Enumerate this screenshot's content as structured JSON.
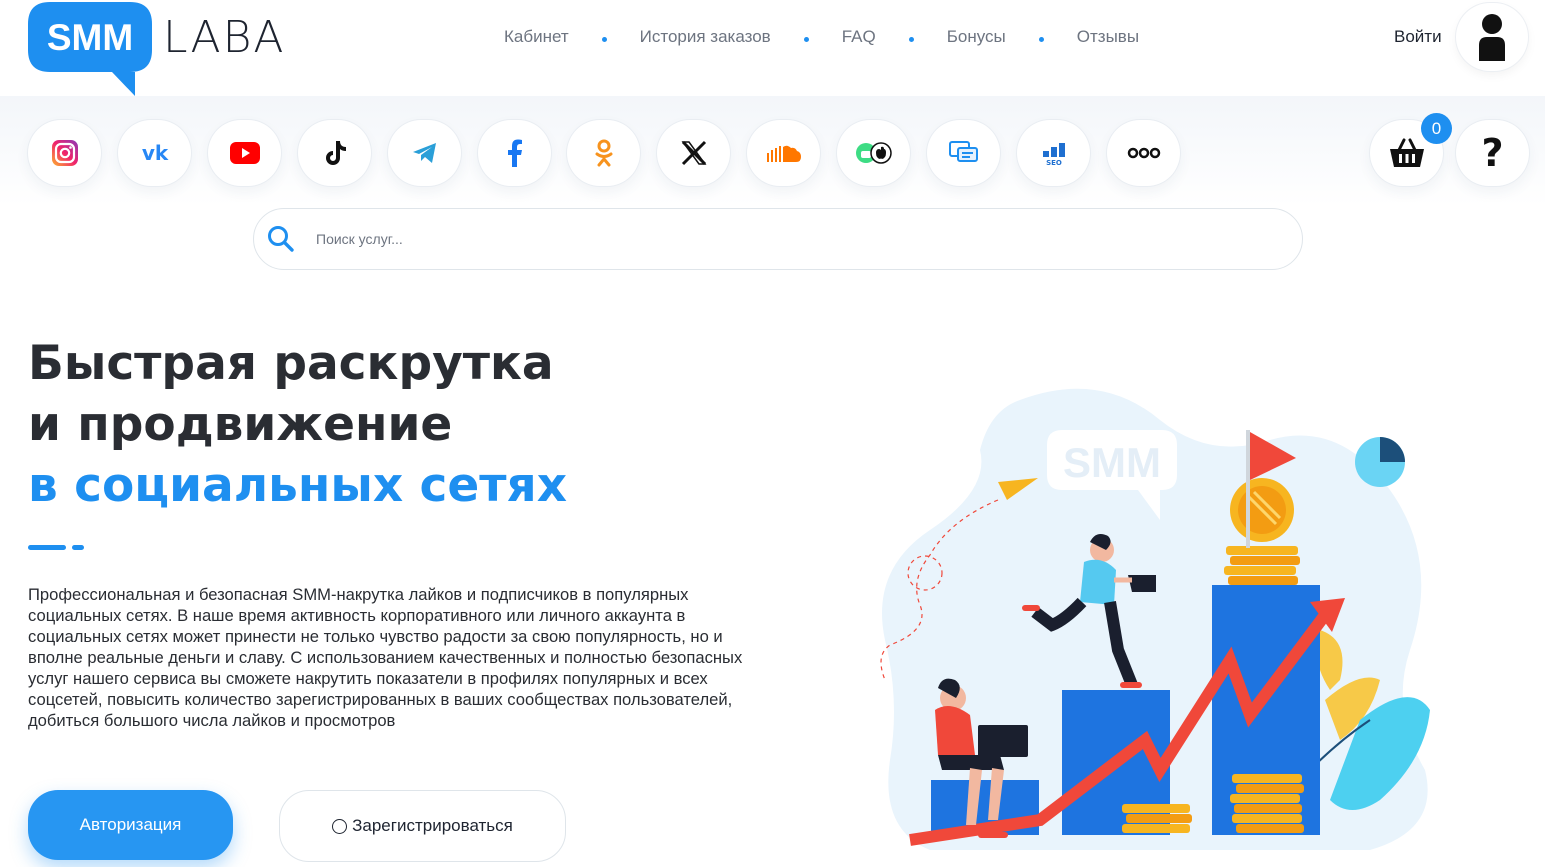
{
  "logo": {
    "part1": "SMM",
    "part2": "LABA"
  },
  "nav": [
    "Кабинет",
    "История заказов",
    "FAQ",
    "Бонусы",
    "Отзывы"
  ],
  "login": {
    "label": "Войти"
  },
  "social_icons": [
    "instagram-icon",
    "vk-icon",
    "youtube-icon",
    "tiktok-icon",
    "telegram-icon",
    "facebook-icon",
    "odnoklassniki-icon",
    "x-icon",
    "soundcloud-icon",
    "apps-icon",
    "chat-icon",
    "seo-icon",
    "more-icon"
  ],
  "cart": {
    "count": "0"
  },
  "help": {
    "label": "?"
  },
  "search": {
    "placeholder": "Поиск услуг..."
  },
  "hero": {
    "title_line1": "Быстрая раскрутка",
    "title_line2": "и продвижение",
    "title_line3": "в социальных сетях",
    "description": "Профессиональная и безопасная SMM-накрутка лайков и подписчиков в популярных социальных сетях. В наше время активность корпоративного или личного аккаунта в социальных сетях может принести не только чувство радости за свою популярность, но и вполне реальные деньги и славу. С использованием качественных и полностью безопасных услуг нашего сервиса вы сможете накрутить показатели в профилях популярных и всех соцсетей, повысить количество зарегистрированных в ваших сообществах пользователей, добиться большого числа лайков и просмотров"
  },
  "buttons": {
    "auth": "Авторизация",
    "register": "Зарегистрироваться"
  },
  "illustration": {
    "bubble_text": "SMM"
  },
  "colors": {
    "accent": "#1e8ff0",
    "dark": "#2a2d33",
    "arrow": "#f0483a",
    "coin": "#f7b520"
  }
}
